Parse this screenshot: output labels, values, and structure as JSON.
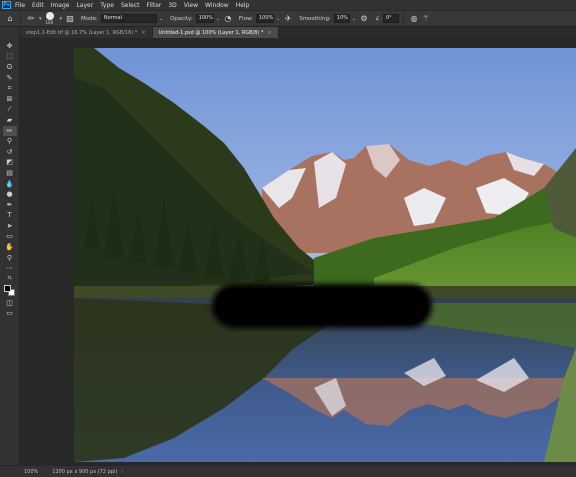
{
  "app": {
    "logo": "Ps"
  },
  "menu": [
    "File",
    "Edit",
    "Image",
    "Layer",
    "Type",
    "Select",
    "Filter",
    "3D",
    "View",
    "Window",
    "Help"
  ],
  "options": {
    "home_icon": "home-icon",
    "tool_icon": "brush-tool-icon",
    "brush_size": "100",
    "mode_label": "Mode:",
    "mode_value": "Normal",
    "opacity_label": "Opacity:",
    "opacity_value": "100%",
    "flow_label": "Flow:",
    "flow_value": "100%",
    "smoothing_label": "Smoothing:",
    "smoothing_value": "10%",
    "angle_symbol": "∠",
    "angle_value": "0°"
  },
  "tabs": [
    {
      "label": "step1.1-Edit.tif @ 16.7% (Layer 1, RGB/16) *",
      "active": false
    },
    {
      "label": "Untitled-1.psd @ 100% (Layer 1, RGB/8) *",
      "active": true
    }
  ],
  "tools": [
    {
      "name": "move-tool",
      "glyph": "✥"
    },
    {
      "name": "marquee-tool",
      "glyph": "⬚"
    },
    {
      "name": "lasso-tool",
      "glyph": "ʘ"
    },
    {
      "name": "quick-select-tool",
      "glyph": "✎"
    },
    {
      "name": "crop-tool",
      "glyph": "⌗"
    },
    {
      "name": "frame-tool",
      "glyph": "⊠"
    },
    {
      "name": "eyedropper-tool",
      "glyph": "⁄"
    },
    {
      "name": "healing-brush-tool",
      "glyph": "▰"
    },
    {
      "name": "brush-tool",
      "glyph": "✏",
      "active": true
    },
    {
      "name": "clone-stamp-tool",
      "glyph": "⚲"
    },
    {
      "name": "history-brush-tool",
      "glyph": "↺"
    },
    {
      "name": "eraser-tool",
      "glyph": "◩"
    },
    {
      "name": "gradient-tool",
      "glyph": "▤"
    },
    {
      "name": "blur-tool",
      "glyph": "💧"
    },
    {
      "name": "dodge-tool",
      "glyph": "●"
    },
    {
      "name": "pen-tool",
      "glyph": "✒"
    },
    {
      "name": "type-tool",
      "glyph": "T"
    },
    {
      "name": "path-select-tool",
      "glyph": "➤"
    },
    {
      "name": "shape-tool",
      "glyph": "▭"
    },
    {
      "name": "hand-tool",
      "glyph": "✋"
    },
    {
      "name": "zoom-tool",
      "glyph": "⚲"
    },
    {
      "name": "more-tools",
      "glyph": "⋯"
    }
  ],
  "toolbar_bottom": {
    "swap_icon": "swap-colors-icon",
    "foreground_color": "#000000",
    "background_color": "#ffffff",
    "quickmask_icon": "quick-mask-icon",
    "screenmode_icon": "screen-mode-icon"
  },
  "status": {
    "zoom": "100%",
    "doc_info": "1200 px x 900 px (72 ppi)",
    "arrow": "›"
  }
}
